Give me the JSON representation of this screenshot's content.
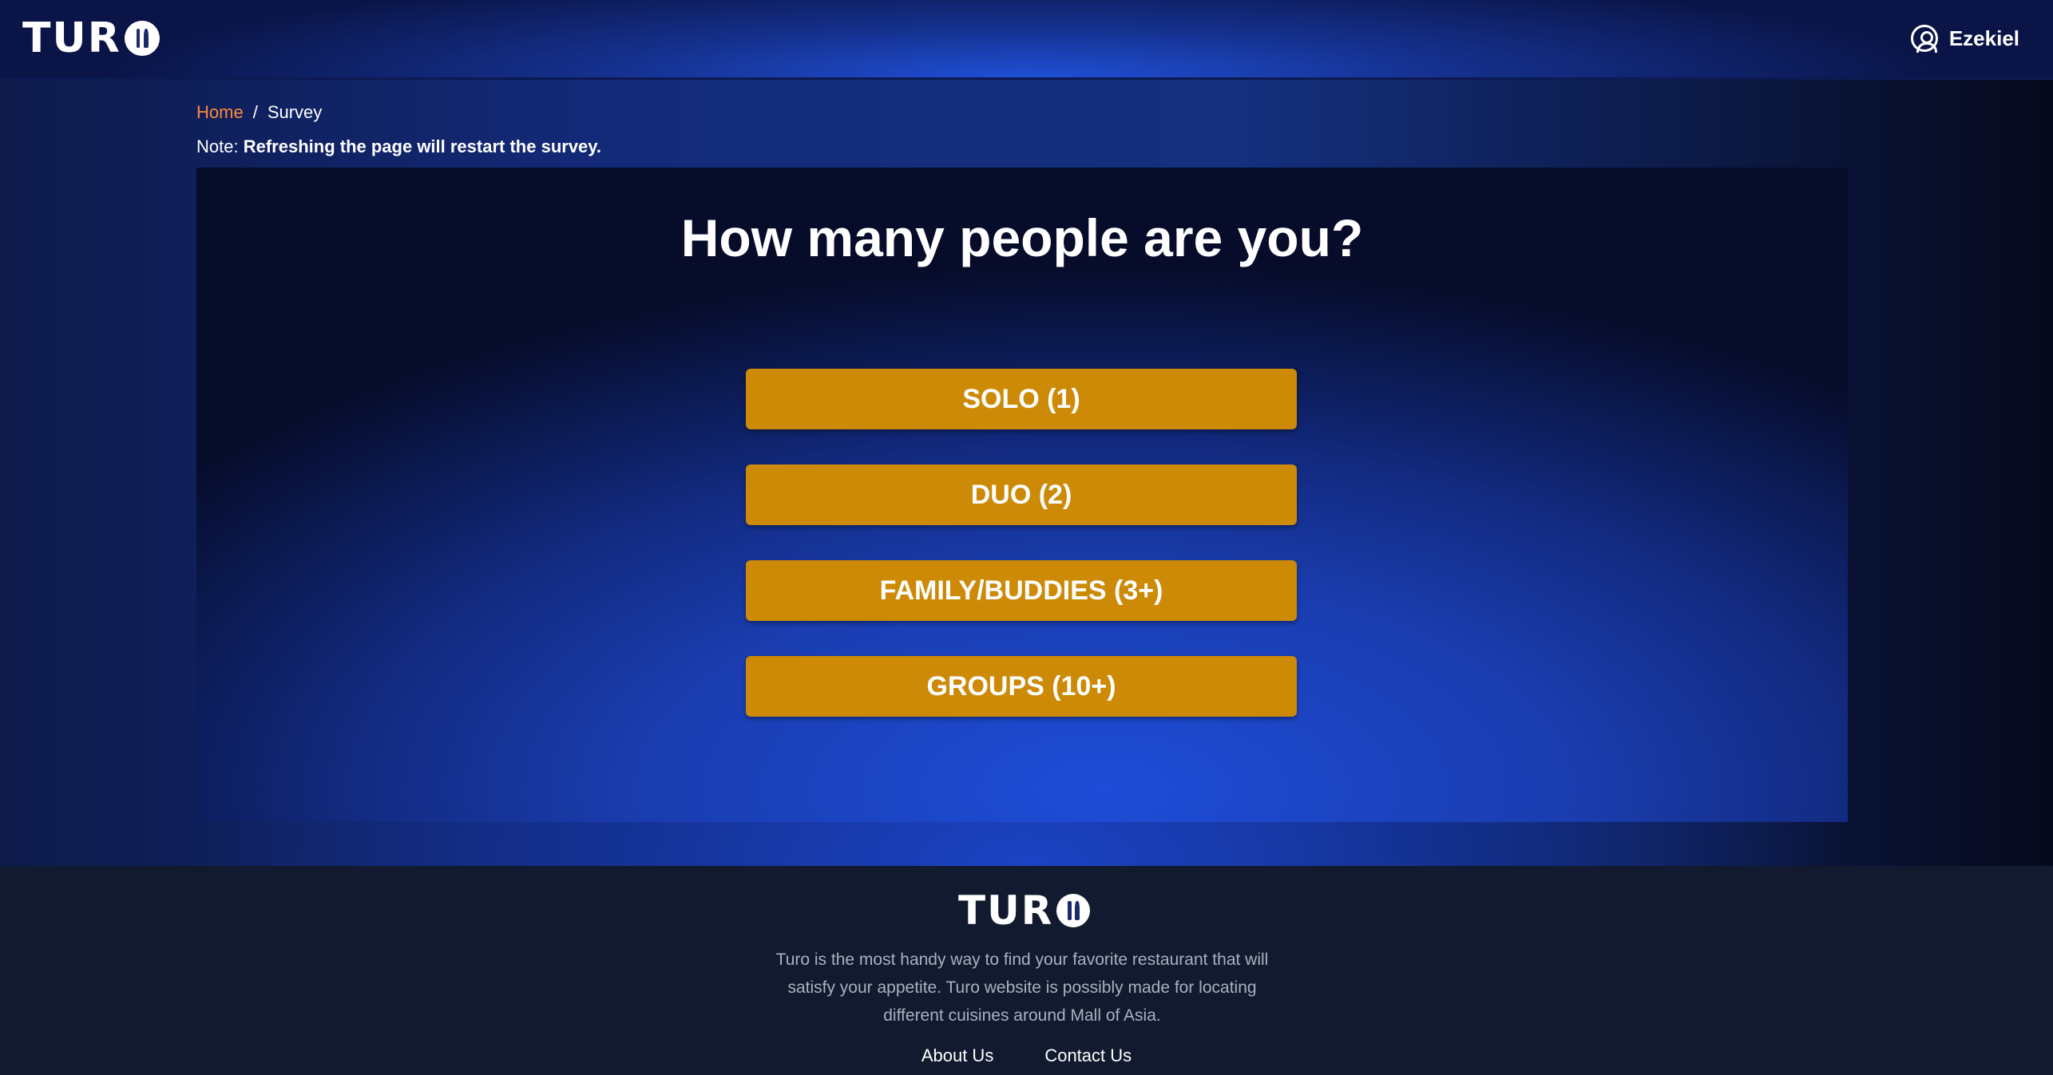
{
  "header": {
    "logo_text": "TUR",
    "logo_icon": "utensils-o-icon",
    "user_name": "Ezekiel",
    "user_icon": "user-circle-icon"
  },
  "breadcrumb": {
    "home": "Home",
    "separator": "/",
    "current": "Survey"
  },
  "note": {
    "label": "Note:",
    "text": "Refreshing the page will restart the survey."
  },
  "survey": {
    "question": "How many people are you?",
    "options": [
      "SOLO (1)",
      "DUO (2)",
      "FAMILY/BUDDIES (3+)",
      "GROUPS (10+)"
    ]
  },
  "footer": {
    "logo_text": "TUR",
    "description": "Turo is the most handy way to find your favorite restaurant that will satisfy your appetite. Turo website is possibly made for locating different cuisines around Mall of Asia.",
    "links": [
      "About Us",
      "Contact Us"
    ]
  },
  "colors": {
    "accent": "#ff8a3d",
    "button": "#cc8a06",
    "footer_bg": "#111a2e"
  }
}
